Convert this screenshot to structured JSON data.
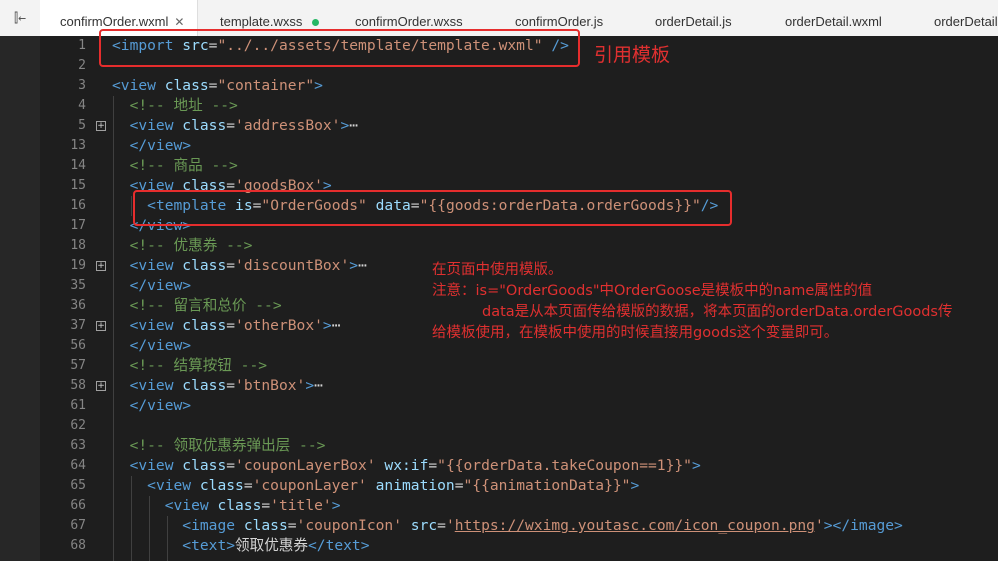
{
  "tabs": [
    {
      "label": "confirmOrder.wxml",
      "active": true,
      "icon": "close-icon"
    },
    {
      "label": "template.wxss",
      "status": "unsaved-dot-icon"
    },
    {
      "label": "confirmOrder.wxss"
    },
    {
      "label": "confirmOrder.js"
    },
    {
      "label": "orderDetail.js"
    },
    {
      "label": "orderDetail.wxml"
    },
    {
      "label": "orderDetail"
    }
  ],
  "lines": [
    {
      "num": "1",
      "tokens": [
        [
          "t",
          "<import "
        ],
        [
          "a",
          "src"
        ],
        [
          "p",
          "="
        ],
        [
          "s",
          "\"../../assets/template/template.wxml\""
        ],
        [
          "t",
          " />"
        ]
      ]
    },
    {
      "num": "2",
      "tokens": []
    },
    {
      "num": "3",
      "tokens": [
        [
          "t",
          "<view "
        ],
        [
          "a",
          "class"
        ],
        [
          "p",
          "="
        ],
        [
          "s",
          "\"container\""
        ],
        [
          "t",
          ">"
        ]
      ]
    },
    {
      "num": "4",
      "tokens": [
        [
          "p",
          "  "
        ],
        [
          "c",
          "<!-- 地址 -->"
        ]
      ]
    },
    {
      "num": "5",
      "fold": true,
      "tokens": [
        [
          "p",
          "  "
        ],
        [
          "t",
          "<view "
        ],
        [
          "a",
          "class"
        ],
        [
          "p",
          "="
        ],
        [
          "s",
          "'addressBox'"
        ],
        [
          "t",
          ">"
        ],
        [
          "p",
          "⋯"
        ]
      ]
    },
    {
      "num": "13",
      "tokens": [
        [
          "p",
          "  "
        ],
        [
          "t",
          "</view>"
        ]
      ]
    },
    {
      "num": "14",
      "tokens": [
        [
          "p",
          "  "
        ],
        [
          "c",
          "<!-- 商品 -->"
        ]
      ]
    },
    {
      "num": "15",
      "tokens": [
        [
          "p",
          "  "
        ],
        [
          "t",
          "<view "
        ],
        [
          "a",
          "class"
        ],
        [
          "p",
          "="
        ],
        [
          "s",
          "'goodsBox'"
        ],
        [
          "t",
          ">"
        ]
      ]
    },
    {
      "num": "16",
      "tokens": [
        [
          "p",
          "    "
        ],
        [
          "t",
          "<template "
        ],
        [
          "a",
          "is"
        ],
        [
          "p",
          "="
        ],
        [
          "s",
          "\"OrderGoods\""
        ],
        [
          "p",
          " "
        ],
        [
          "a",
          "data"
        ],
        [
          "p",
          "="
        ],
        [
          "s",
          "\"{{goods:orderData.orderGoods}}\""
        ],
        [
          "t",
          "/>"
        ]
      ]
    },
    {
      "num": "17",
      "tokens": [
        [
          "p",
          "  "
        ],
        [
          "t",
          "</view>"
        ]
      ]
    },
    {
      "num": "18",
      "tokens": [
        [
          "p",
          "  "
        ],
        [
          "c",
          "<!-- 优惠券 -->"
        ]
      ]
    },
    {
      "num": "19",
      "fold": true,
      "tokens": [
        [
          "p",
          "  "
        ],
        [
          "t",
          "<view "
        ],
        [
          "a",
          "class"
        ],
        [
          "p",
          "="
        ],
        [
          "s",
          "'discountBox'"
        ],
        [
          "t",
          ">"
        ],
        [
          "p",
          "⋯"
        ]
      ]
    },
    {
      "num": "35",
      "tokens": [
        [
          "p",
          "  "
        ],
        [
          "t",
          "</view>"
        ]
      ]
    },
    {
      "num": "36",
      "tokens": [
        [
          "p",
          "  "
        ],
        [
          "c",
          "<!-- 留言和总价 -->"
        ]
      ]
    },
    {
      "num": "37",
      "fold": true,
      "tokens": [
        [
          "p",
          "  "
        ],
        [
          "t",
          "<view "
        ],
        [
          "a",
          "class"
        ],
        [
          "p",
          "="
        ],
        [
          "s",
          "'otherBox'"
        ],
        [
          "t",
          ">"
        ],
        [
          "p",
          "⋯"
        ]
      ]
    },
    {
      "num": "56",
      "tokens": [
        [
          "p",
          "  "
        ],
        [
          "t",
          "</view>"
        ]
      ]
    },
    {
      "num": "57",
      "tokens": [
        [
          "p",
          "  "
        ],
        [
          "c",
          "<!-- 结算按钮 -->"
        ]
      ]
    },
    {
      "num": "58",
      "fold": true,
      "tokens": [
        [
          "p",
          "  "
        ],
        [
          "t",
          "<view "
        ],
        [
          "a",
          "class"
        ],
        [
          "p",
          "="
        ],
        [
          "s",
          "'btnBox'"
        ],
        [
          "t",
          ">"
        ],
        [
          "p",
          "⋯"
        ]
      ]
    },
    {
      "num": "61",
      "tokens": [
        [
          "p",
          "  "
        ],
        [
          "t",
          "</view>"
        ]
      ]
    },
    {
      "num": "62",
      "tokens": []
    },
    {
      "num": "63",
      "tokens": [
        [
          "p",
          "  "
        ],
        [
          "c",
          "<!-- 领取优惠券弹出层 -->"
        ]
      ]
    },
    {
      "num": "64",
      "tokens": [
        [
          "p",
          "  "
        ],
        [
          "t",
          "<view "
        ],
        [
          "a",
          "class"
        ],
        [
          "p",
          "="
        ],
        [
          "s",
          "'couponLayerBox'"
        ],
        [
          "p",
          " "
        ],
        [
          "a",
          "wx:if"
        ],
        [
          "p",
          "="
        ],
        [
          "s",
          "\"{{orderData.takeCoupon==1}}\""
        ],
        [
          "t",
          ">"
        ]
      ]
    },
    {
      "num": "65",
      "tokens": [
        [
          "p",
          "    "
        ],
        [
          "t",
          "<view "
        ],
        [
          "a",
          "class"
        ],
        [
          "p",
          "="
        ],
        [
          "s",
          "'couponLayer'"
        ],
        [
          "p",
          " "
        ],
        [
          "a",
          "animation"
        ],
        [
          "p",
          "="
        ],
        [
          "s",
          "\"{{animationData}}\""
        ],
        [
          "t",
          ">"
        ]
      ]
    },
    {
      "num": "66",
      "tokens": [
        [
          "p",
          "      "
        ],
        [
          "t",
          "<view "
        ],
        [
          "a",
          "class"
        ],
        [
          "p",
          "="
        ],
        [
          "s",
          "'title'"
        ],
        [
          "t",
          ">"
        ]
      ]
    },
    {
      "num": "67",
      "tokens": [
        [
          "p",
          "        "
        ],
        [
          "t",
          "<image "
        ],
        [
          "a",
          "class"
        ],
        [
          "p",
          "="
        ],
        [
          "s",
          "'couponIcon'"
        ],
        [
          "p",
          " "
        ],
        [
          "a",
          "src"
        ],
        [
          "p",
          "="
        ],
        [
          "s",
          "'"
        ],
        [
          "u",
          "https://wximg.youtasc.com/icon_coupon.png"
        ],
        [
          "s",
          "'"
        ],
        [
          "t",
          "></image>"
        ]
      ]
    },
    {
      "num": "68",
      "tokens": [
        [
          "p",
          "        "
        ],
        [
          "t",
          "<text>"
        ],
        [
          "p",
          "领取优惠券"
        ],
        [
          "t",
          "</text>"
        ]
      ]
    }
  ],
  "annotations": {
    "import_note": "引用模板",
    "usage_title": "在页面中使用模版。",
    "usage_line1": "注意：is=\"OrderGoods\"中OrderGoose是模板中的name属性的值",
    "usage_line2": "data是从本页面传给模版的数据，将本页面的orderData.orderGoods传",
    "usage_line3": "给模板使用，在模板中使用的时候直接用goods这个变量即可。"
  },
  "colors": {
    "annotation_red": "#e03030",
    "tag": "#569cd6",
    "attribute": "#9cdcfe",
    "string": "#ce9178",
    "comment": "#6a9955"
  }
}
